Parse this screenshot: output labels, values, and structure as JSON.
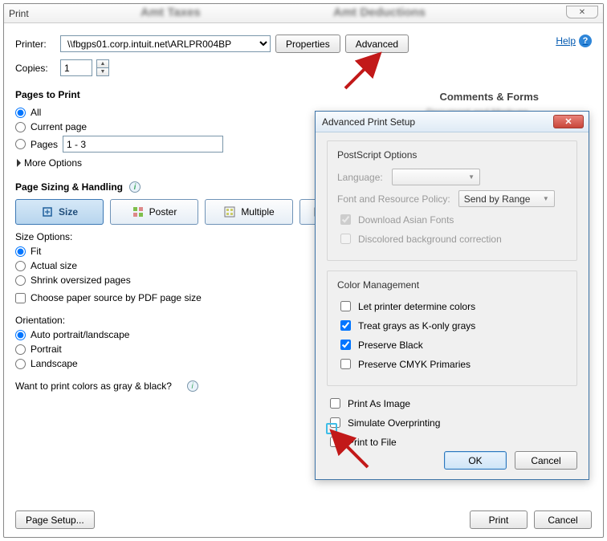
{
  "window": {
    "title": "Print",
    "bg_blur1": "Amt Taxes",
    "bg_blur2": "Amt Deductions"
  },
  "toolbar": {
    "printer_label": "Printer:",
    "printer_value": "\\\\fbgps01.corp.intuit.net\\ARLPR004BP",
    "properties": "Properties",
    "advanced": "Advanced",
    "help": "Help",
    "copies_label": "Copies:",
    "copies_value": "1"
  },
  "pages": {
    "title": "Pages to Print",
    "all": "All",
    "current": "Current page",
    "pages": "Pages",
    "pages_value": "1 - 3",
    "more": "More Options"
  },
  "sizing": {
    "title": "Page Sizing & Handling",
    "size": "Size",
    "poster": "Poster",
    "multiple": "Multiple",
    "size_options": "Size Options:",
    "fit": "Fit",
    "actual": "Actual size",
    "shrink": "Shrink oversized pages",
    "choose_source": "Choose paper source by PDF page size"
  },
  "orientation": {
    "label": "Orientation:",
    "auto": "Auto portrait/landscape",
    "portrait": "Portrait",
    "landscape": "Landscape"
  },
  "grayq": "Want to print colors as gray & black?",
  "comments": {
    "title": "Comments & Forms",
    "sub": "Document and Markups"
  },
  "footer": {
    "page_setup": "Page Setup...",
    "print": "Print",
    "cancel": "Cancel"
  },
  "modal": {
    "title": "Advanced Print Setup",
    "postscript": {
      "title": "PostScript Options",
      "language": "Language:",
      "policy": "Font and Resource Policy:",
      "policy_value": "Send by Range",
      "asian": "Download Asian Fonts",
      "discolored": "Discolored background correction"
    },
    "color": {
      "title": "Color Management",
      "let_printer": "Let printer determine colors",
      "grays": "Treat grays as K-only grays",
      "black": "Preserve Black",
      "cmyk": "Preserve CMYK Primaries"
    },
    "print_image": "Print As Image",
    "simulate": "Simulate Overprinting",
    "to_file": "Print to File",
    "ok": "OK",
    "cancel": "Cancel"
  }
}
